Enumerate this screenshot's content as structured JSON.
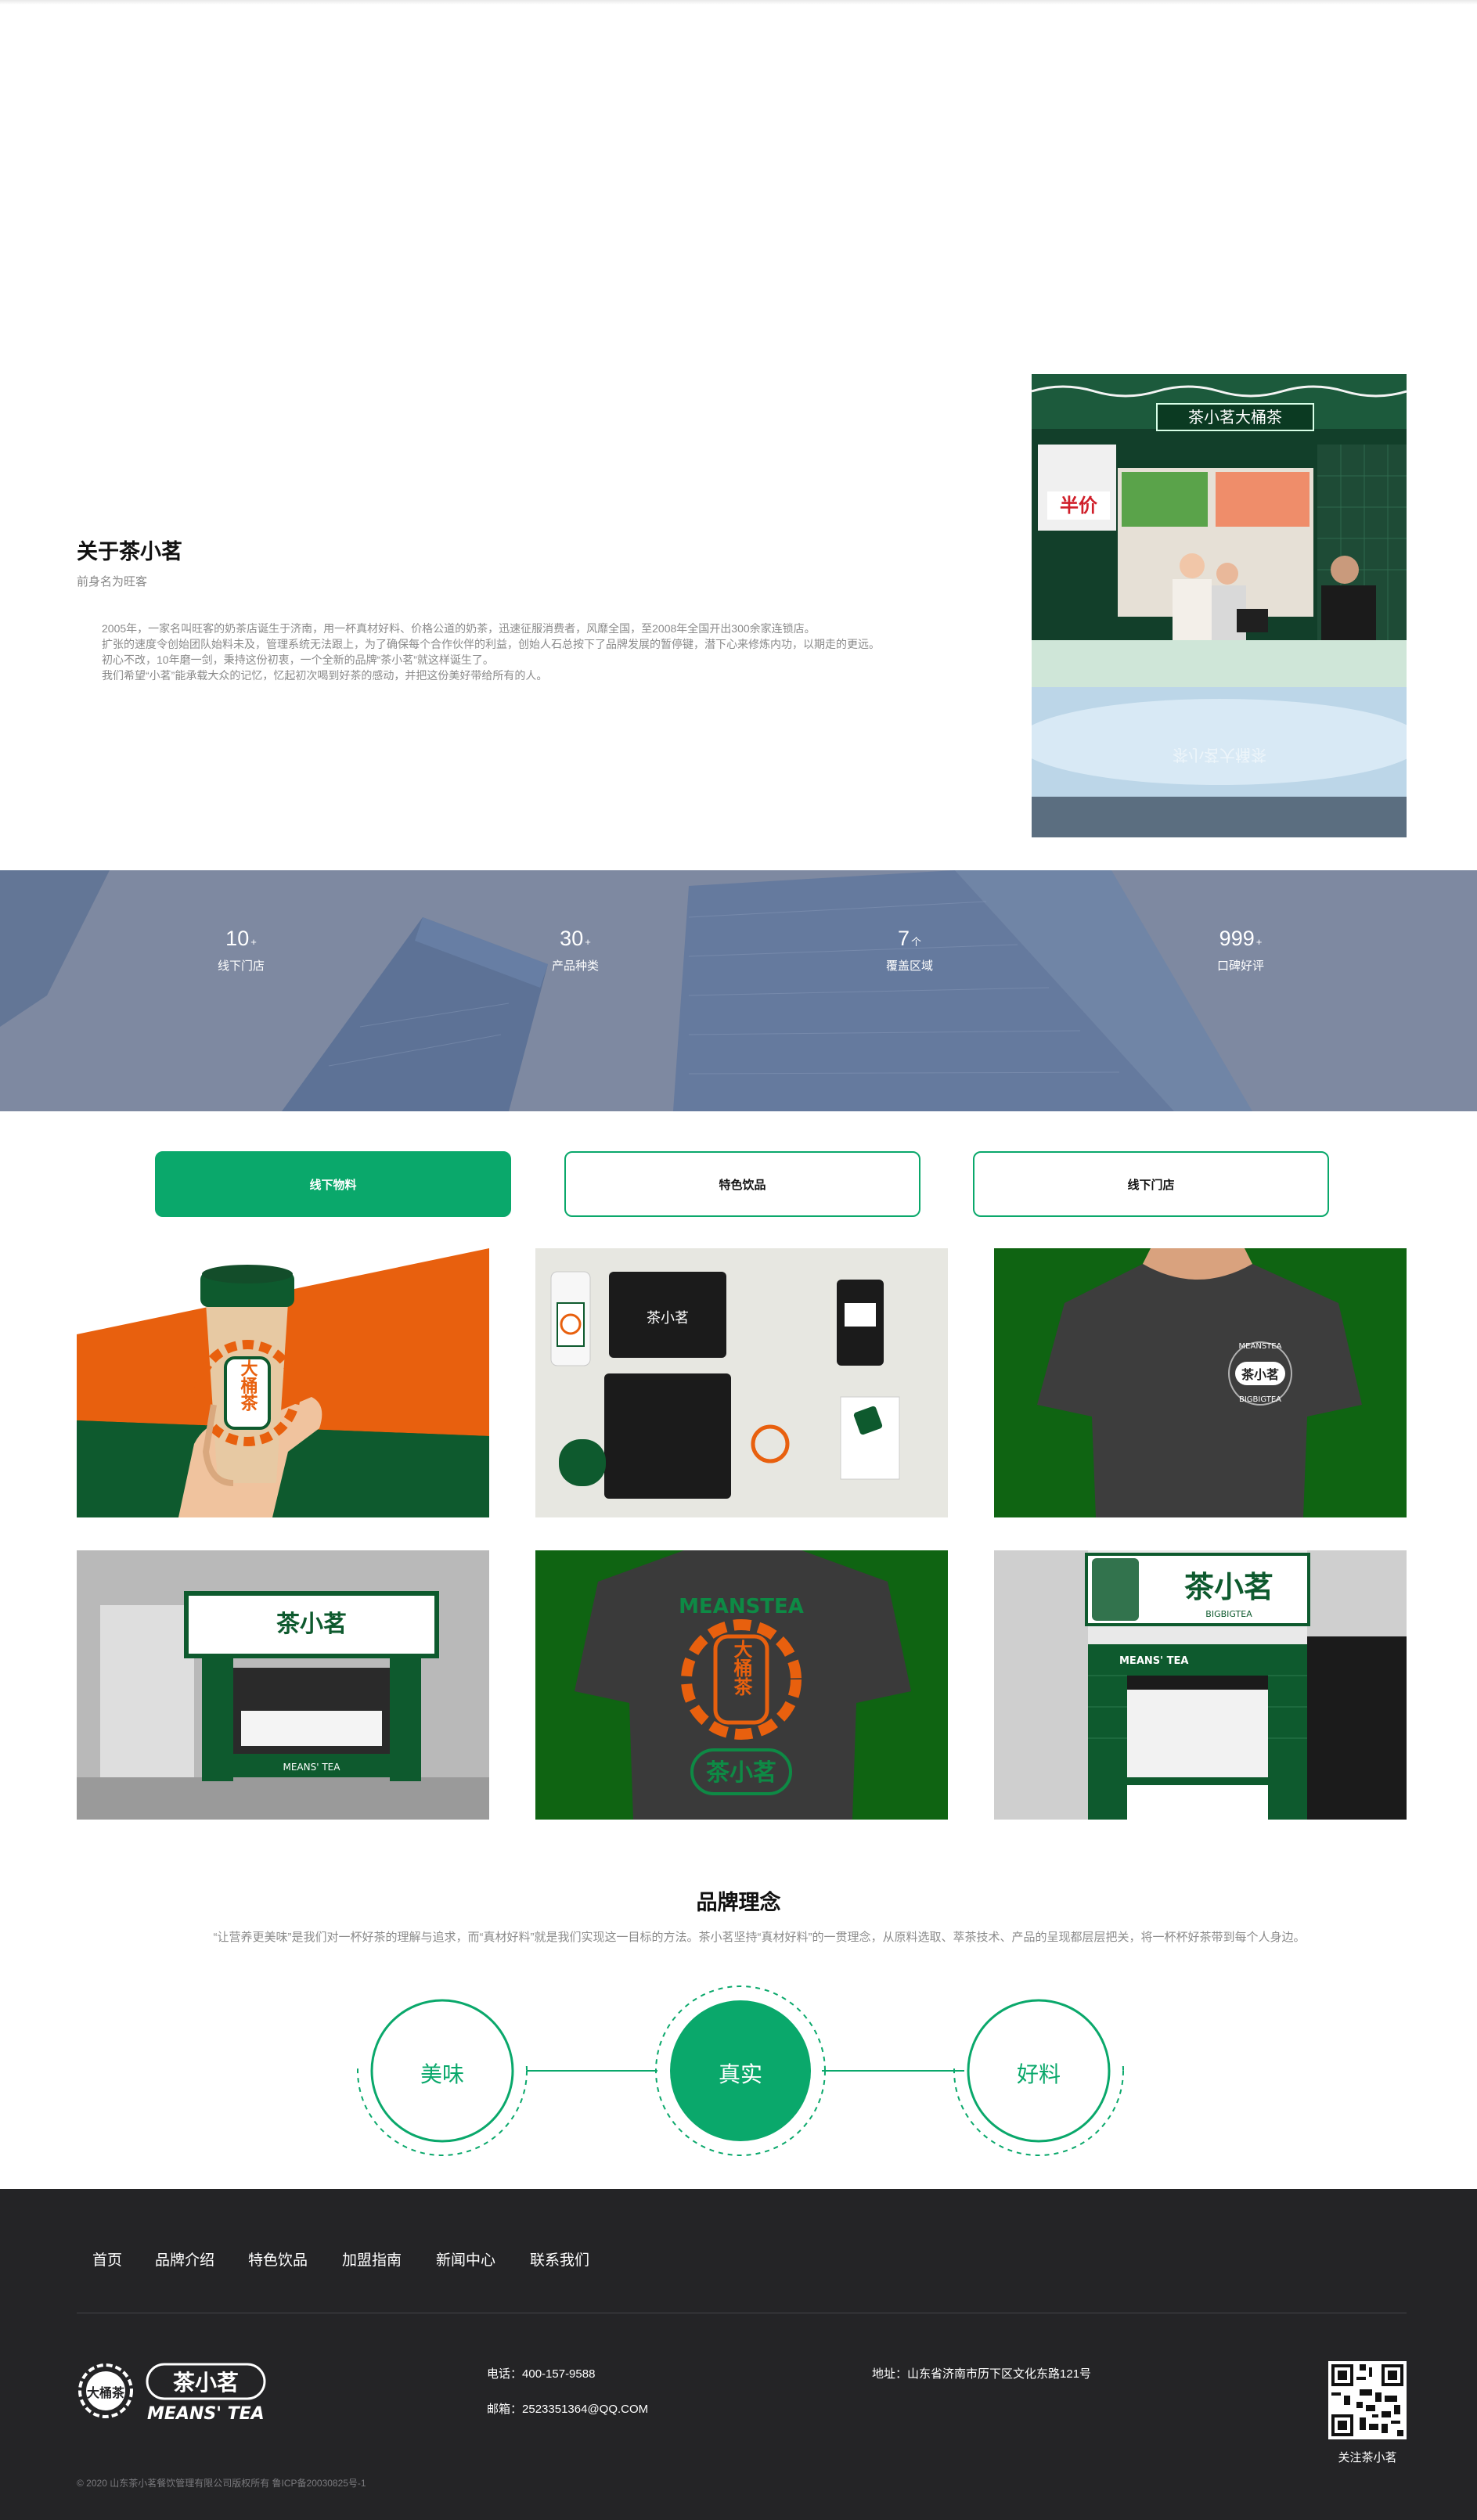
{
  "about": {
    "title": "关于茶小茗",
    "subtitle": "前身名为旺客",
    "paragraphs": [
      "2005年，一家名叫旺客的奶茶店诞生于济南，用一杯真材好料、价格公道的奶茶，迅速征服消费者，风靡全国，至2008年全国开出300余家连锁店。",
      "扩张的速度令创始团队始料未及，管理系统无法跟上，为了确保每个合作伙伴的利益，创始人石总按下了品牌发展的暂停键，潜下心来修炼内功，以期走的更远。",
      "初心不改，10年磨一剑，秉持这份初衷，一个全新的品牌“茶小茗”就这样诞生了。",
      "我们希望“小茗”能承载大众的记忆，忆起初次喝到好茶的感动，并把这份美好带给所有的人。"
    ],
    "photo_sign": "茶小茗大桶茶",
    "photo_price": "半价"
  },
  "stats": [
    {
      "value": "10",
      "unit": "+",
      "label": "线下门店"
    },
    {
      "value": "30",
      "unit": "+",
      "label": "产品种类"
    },
    {
      "value": "7",
      "unit": "个",
      "label": "覆盖区域"
    },
    {
      "value": "999",
      "unit": "+",
      "label": "口碑好评"
    }
  ],
  "tabs": [
    {
      "label": "线下物料",
      "active": true
    },
    {
      "label": "特色饮品",
      "active": false
    },
    {
      "label": "线下门店",
      "active": false
    }
  ],
  "gallery": {
    "cup_text": "大桶茶",
    "shirt_text": "茶小茗",
    "shirt_sub_top": "MEANSTEA",
    "shirt_sub_bottom": "BIGBIGTEA",
    "back_arc": "MEANSTEA",
    "back_logo": "大桶茶",
    "back_bottom": "茶小茗",
    "store_sign": "茶小茗",
    "store_sub": "BIGBIGTEA",
    "store_brand": "MEANS' TEA"
  },
  "concept": {
    "title": "品牌理念",
    "text": "“让营养更美味”是我们对一杯好茶的理解与追求，而“真材好料”就是我们实现这一目标的方法。茶小茗坚持“真材好料”的一贯理念，从原料选取、萃茶技术、产品的呈现都层层把关，将一杯杯好茶带到每个人身边。",
    "items": [
      "美味",
      "真实",
      "好料"
    ]
  },
  "footer": {
    "nav": [
      "首页",
      "品牌介绍",
      "特色饮品",
      "加盟指南",
      "新闻中心",
      "联系我们"
    ],
    "logo_badge": "大桶茶",
    "logo_name": "茶小茗",
    "logo_en": "MEANS' TEA",
    "phone_label": "电话：",
    "phone": "400-157-9588",
    "email_label": "邮箱：",
    "email": "2523351364@QQ.COM",
    "address_label": "地址：",
    "address": "山东省济南市历下区文化东路121号",
    "qr_label": "关注茶小茗",
    "copyright": "© 2020 山东茶小茗餐饮管理有限公司版权所有 鲁ICP备20030825号-1"
  },
  "colors": {
    "accent_green": "#0aa86b",
    "brand_dark_green": "#0e5a2e",
    "brand_orange": "#e8600e",
    "footer_bg": "#242426",
    "stats_bg": "#7b86a0"
  }
}
